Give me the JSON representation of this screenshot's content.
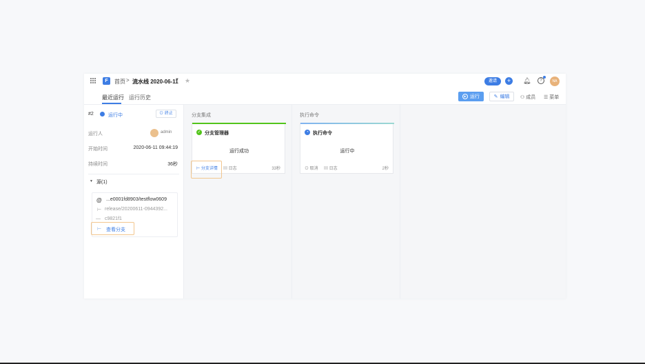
{
  "header": {
    "breadcrumb_home": "首页",
    "breadcrumb_sep": ">",
    "pipeline_title": "流水线 2020-06-11",
    "invite_label": "邀请",
    "avatar_text": "NA"
  },
  "tabs": [
    {
      "label": "最近运行",
      "active": true
    },
    {
      "label": "运行历史",
      "active": false
    }
  ],
  "toolbar": {
    "run_label": "运行",
    "edit_label": "编辑",
    "members_label": "成员",
    "menu_label": "菜单"
  },
  "run": {
    "number": "#2",
    "status": "运行中",
    "stop_label": "终止",
    "runner_label": "运行人",
    "runner_name": "admin",
    "start_label": "开始时间",
    "start_value": "2020-06-11 09:44:19",
    "duration_label": "持续时间",
    "duration_value": "36秒"
  },
  "source": {
    "title": "源(1)",
    "repo": "...e0001fd8903/testflow0609",
    "branch": "release/20200611-0944392...",
    "commit": "c9821f1",
    "link_label": "查看分支"
  },
  "stages": [
    {
      "title": "分支集成",
      "job": {
        "name": "分支管理器",
        "result": "运行成功",
        "status_color": "#52c41a",
        "link1": "分支详情",
        "link2": "日志",
        "time": "33秒"
      }
    },
    {
      "title": "执行命令",
      "job": {
        "name": "执行命令",
        "result": "运行中",
        "status_color": "#3d7de4",
        "link1": "取消",
        "link2": "日志",
        "time": "2秒"
      }
    }
  ],
  "colors": {
    "accent": "#3d7de4",
    "success": "#52c41a",
    "highlight": "#f2c68e"
  }
}
